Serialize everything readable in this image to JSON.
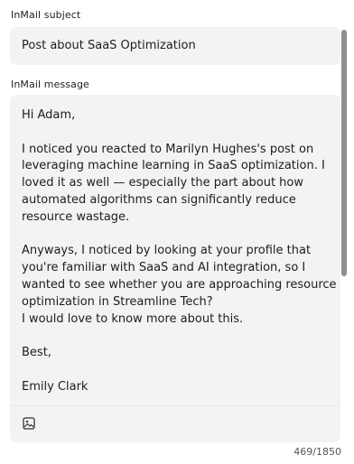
{
  "subject": {
    "label": "InMail subject",
    "value": "Post about SaaS Optimization"
  },
  "message": {
    "label": "InMail message",
    "value": "Hi Adam,\n\nI noticed you reacted to Marilyn Hughes's post on leveraging machine learning in SaaS optimization. I loved it as well — especially the part about how automated algorithms can significantly reduce resource wastage.\n\nAnyways, I noticed by looking at your profile that you're familiar with SaaS and AI integration, so I wanted to see whether you are approaching resource optimization in Streamline Tech?\nI would love to know more about this.\n\nBest,\n\nEmily Clark",
    "image_icon": "image-icon"
  },
  "counter": "469/1850"
}
